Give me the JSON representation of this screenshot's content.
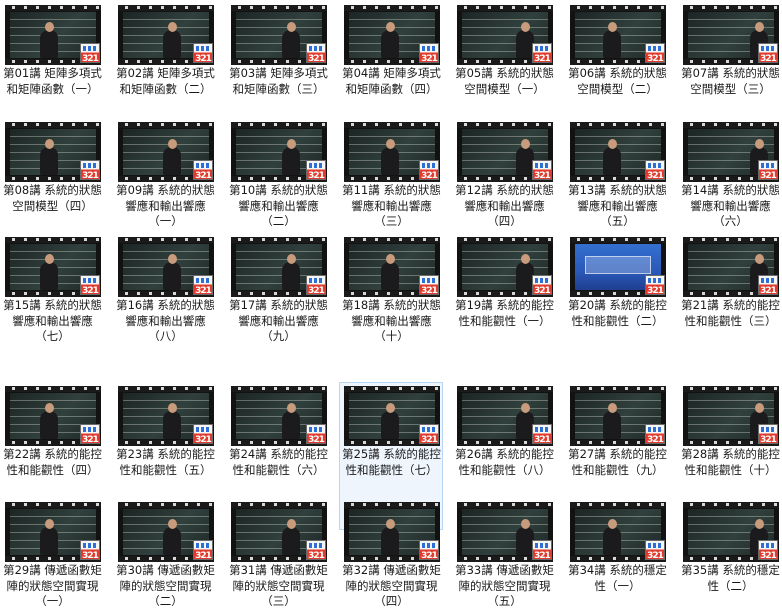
{
  "videos": [
    {
      "title": "第01講 矩陣多項式和矩陣函數（一）",
      "badge": "321",
      "thumb": "lecture"
    },
    {
      "title": "第02講 矩陣多項式和矩陣函數（二）",
      "badge": "321",
      "thumb": "lecture"
    },
    {
      "title": "第03講 矩陣多項式和矩陣函數（三）",
      "badge": "321",
      "thumb": "lecture"
    },
    {
      "title": "第04講 矩陣多項式和矩陣函數（四）",
      "badge": "321",
      "thumb": "lecture"
    },
    {
      "title": "第05講 系統的狀態空間模型（一）",
      "badge": "321",
      "thumb": "lecture"
    },
    {
      "title": "第06講 系統的狀態空間模型（二）",
      "badge": "321",
      "thumb": "lecture"
    },
    {
      "title": "第07講 系統的狀態空間模型（三）",
      "badge": "321",
      "thumb": "lecture"
    },
    {
      "title": "第08講 系統的狀態空間模型（四）",
      "badge": "321",
      "thumb": "lecture"
    },
    {
      "title": "第09講 系統的狀態響應和輸出響應（一）",
      "badge": "321",
      "thumb": "lecture"
    },
    {
      "title": "第10講 系統的狀態響應和輸出響應（二）",
      "badge": "321",
      "thumb": "lecture"
    },
    {
      "title": "第11講 系統的狀態響應和輸出響應（三）",
      "badge": "321",
      "thumb": "lecture"
    },
    {
      "title": "第12講 系統的狀態響應和輸出響應（四）",
      "badge": "321",
      "thumb": "lecture"
    },
    {
      "title": "第13講 系統的狀態響應和輸出響應（五）",
      "badge": "321",
      "thumb": "lecture"
    },
    {
      "title": "第14講 系統的狀態響應和輸出響應（六）",
      "badge": "321",
      "thumb": "lecture"
    },
    {
      "title": "第15講 系統的狀態響應和輸出響應（七）",
      "badge": "321",
      "thumb": "lecture"
    },
    {
      "title": "第16講 系統的狀態響應和輸出響應（八）",
      "badge": "321",
      "thumb": "lecture"
    },
    {
      "title": "第17講 系統的狀態響應和輸出響應（九）",
      "badge": "321",
      "thumb": "lecture"
    },
    {
      "title": "第18講 系統的狀態響應和輸出響應（十）",
      "badge": "321",
      "thumb": "lecture"
    },
    {
      "title": "第19講 系統的能控性和能觀性（一）",
      "badge": "321",
      "thumb": "lecture"
    },
    {
      "title": "第20講 系統的能控性和能觀性（二）",
      "badge": "321",
      "thumb": "slide"
    },
    {
      "title": "第21講 系統的能控性和能觀性（三）",
      "badge": "321",
      "thumb": "lecture"
    },
    {
      "title": "第22講 系統的能控性和能觀性（四）",
      "badge": "321",
      "thumb": "lecture"
    },
    {
      "title": "第23講 系統的能控性和能觀性（五）",
      "badge": "321",
      "thumb": "lecture"
    },
    {
      "title": "第24講 系統的能控性和能觀性（六）",
      "badge": "321",
      "thumb": "lecture"
    },
    {
      "title": "第25講 系統的能控性和能觀性（七）",
      "badge": "321",
      "thumb": "lecture",
      "selected": true
    },
    {
      "title": "第26講 系統的能控性和能觀性（八）",
      "badge": "321",
      "thumb": "lecture"
    },
    {
      "title": "第27講 系統的能控性和能觀性（九）",
      "badge": "321",
      "thumb": "lecture"
    },
    {
      "title": "第28講 系統的能控性和能觀性（十）",
      "badge": "321",
      "thumb": "lecture"
    },
    {
      "title": "第29講 傳遞函數矩陣的狀態空間實現（一）",
      "badge": "321",
      "thumb": "lecture"
    },
    {
      "title": "第30講 傳遞函數矩陣的狀態空間實現（二）",
      "badge": "321",
      "thumb": "lecture"
    },
    {
      "title": "第31講 傳遞函數矩陣的狀態空間實現（三）",
      "badge": "321",
      "thumb": "lecture"
    },
    {
      "title": "第32講 傳遞函數矩陣的狀態空間實現（四）",
      "badge": "321",
      "thumb": "lecture"
    },
    {
      "title": "第33講 傳遞函數矩陣的狀態空間實現（五）",
      "badge": "321",
      "thumb": "lecture"
    },
    {
      "title": "第34講 系統的穩定性（一）",
      "badge": "321",
      "thumb": "lecture"
    },
    {
      "title": "第35講 系統的穩定性（二）",
      "badge": "321",
      "thumb": "lecture"
    }
  ],
  "colors": {
    "selected_background": "#eef5fd",
    "selected_border": "#b8d6f6",
    "badge_red": "#e03b2c",
    "label_text": "#1a1a1a"
  }
}
